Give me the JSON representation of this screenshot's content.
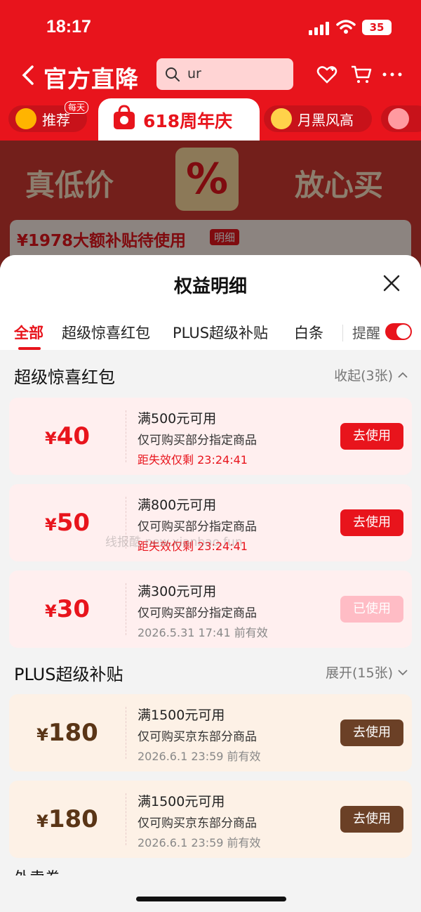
{
  "status": {
    "time": "18:17",
    "battery": "35"
  },
  "header": {
    "brand": "官方直降",
    "search_value": "ur"
  },
  "categories": {
    "badge_daily": "每天",
    "items": [
      {
        "label": "推荐"
      },
      {
        "label": "618周年庆"
      },
      {
        "label": "月黑风高"
      }
    ]
  },
  "banner": {
    "left_text": "真低价",
    "right_text": "放心买",
    "percent": "%",
    "subsidy": "¥1978大额补贴待使用",
    "detail": "明细"
  },
  "sheet": {
    "title": "权益明细",
    "tabs": [
      "全部",
      "超级惊喜红包",
      "PLUS超级补贴",
      "白条"
    ],
    "remind": "提醒",
    "sections": [
      {
        "title": "超级惊喜红包",
        "toggle": "收起(3张)",
        "cards": [
          {
            "currency": "¥",
            "amount": "40",
            "l1": "满500元可用",
            "l2": "仅可购买部分指定商品",
            "l3": "距失效仅剩 23:24:41",
            "button": "去使用"
          },
          {
            "currency": "¥",
            "amount": "50",
            "l1": "满800元可用",
            "l2": "仅可购买部分指定商品",
            "l3": "距失效仅剩 23:24:41",
            "button": "去使用"
          },
          {
            "currency": "¥",
            "amount": "30",
            "l1": "满300元可用",
            "l2": "仅可购买部分指定商品",
            "l3": "2026.5.31 17:41 前有效",
            "button": "已使用"
          }
        ]
      },
      {
        "title": "PLUS超级补贴",
        "toggle": "展开(15张)",
        "cards": [
          {
            "currency": "¥",
            "amount": "180",
            "l1": "满1500元可用",
            "l2": "仅可购买京东部分商品",
            "l3": "2026.6.1 23:59 前有效",
            "button": "去使用"
          },
          {
            "currency": "¥",
            "amount": "180",
            "l1": "满1500元可用",
            "l2": "仅可购买京东部分商品",
            "l3": "2026.6.1 23:59 前有效",
            "button": "去使用"
          }
        ]
      }
    ],
    "next_section_peek": "外卖券"
  },
  "watermark": "线报酷 new.xianbao.fun",
  "colors": {
    "accent": "#e8141c",
    "brown": "#6b4026",
    "used": "#ffbcc5"
  }
}
